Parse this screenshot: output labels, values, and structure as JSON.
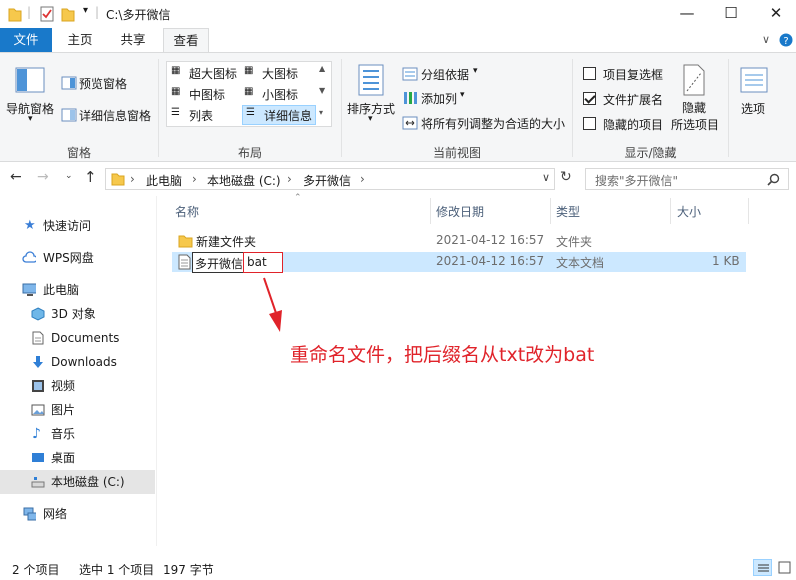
{
  "window": {
    "title": "C:\\多开微信",
    "min": "—",
    "max": "☐",
    "close": "✕"
  },
  "ribbon_tabs": [
    "文件",
    "主页",
    "共享",
    "查看"
  ],
  "ribbon": {
    "pane": {
      "nav_pane": "导航窗格",
      "preview_pane": "预览窗格",
      "details_pane": "详细信息窗格",
      "group_label": "窗格"
    },
    "layout": {
      "items": [
        "超大图标",
        "大图标",
        "中图标",
        "小图标",
        "列表",
        "详细信息"
      ],
      "group_label": "布局"
    },
    "current_view": {
      "sort_by": "排序方式",
      "group_by": "分组依据",
      "add_column": "添加列",
      "fit_columns": "将所有列调整为合适的大小",
      "group_label": "当前视图"
    },
    "show_hide": {
      "item_checkboxes": "项目复选框",
      "item_checkboxes_checked": false,
      "file_extensions": "文件扩展名",
      "file_extensions_checked": true,
      "hidden_items": "隐藏的项目",
      "hidden_items_checked": false,
      "hide_selected_1": "隐藏",
      "hide_selected_2": "所选项目",
      "group_label": "显示/隐藏"
    },
    "options": "选项"
  },
  "address": {
    "crumbs": [
      "此电脑",
      "本地磁盘 (C:)",
      "多开微信"
    ],
    "search_placeholder": "搜索\"多开微信\""
  },
  "sidebar": [
    {
      "label": "快速访问",
      "icon": "star-icon"
    },
    {
      "label": "WPS网盘",
      "icon": "cloud-icon"
    },
    {
      "label": "此电脑",
      "icon": "computer-icon"
    },
    {
      "label": "3D 对象",
      "icon": "cube-icon"
    },
    {
      "label": "Documents",
      "icon": "document-icon"
    },
    {
      "label": "Downloads",
      "icon": "download-icon"
    },
    {
      "label": "视频",
      "icon": "video-icon"
    },
    {
      "label": "图片",
      "icon": "picture-icon"
    },
    {
      "label": "音乐",
      "icon": "music-icon"
    },
    {
      "label": "桌面",
      "icon": "desktop-icon"
    },
    {
      "label": "本地磁盘 (C:)",
      "icon": "drive-icon"
    },
    {
      "label": "网络",
      "icon": "network-icon"
    }
  ],
  "columns": [
    "名称",
    "修改日期",
    "类型",
    "大小"
  ],
  "files": [
    {
      "name": "新建文件夹",
      "modified": "2021-04-12 16:57",
      "type": "文件夹",
      "size": ""
    },
    {
      "name_base": "多开微信",
      "name_ext": "bat",
      "modified": "2021-04-12 16:57",
      "type": "文本文档",
      "size": "1 KB"
    }
  ],
  "annotation": "重命名文件，把后缀名从txt改为bat",
  "status": {
    "count": "2 个项目",
    "selected": "选中 1 个项目",
    "size": "197 字节"
  },
  "colors": {
    "accent": "#1979ca",
    "selection": "#cce8ff",
    "annotation": "#e0232a"
  }
}
